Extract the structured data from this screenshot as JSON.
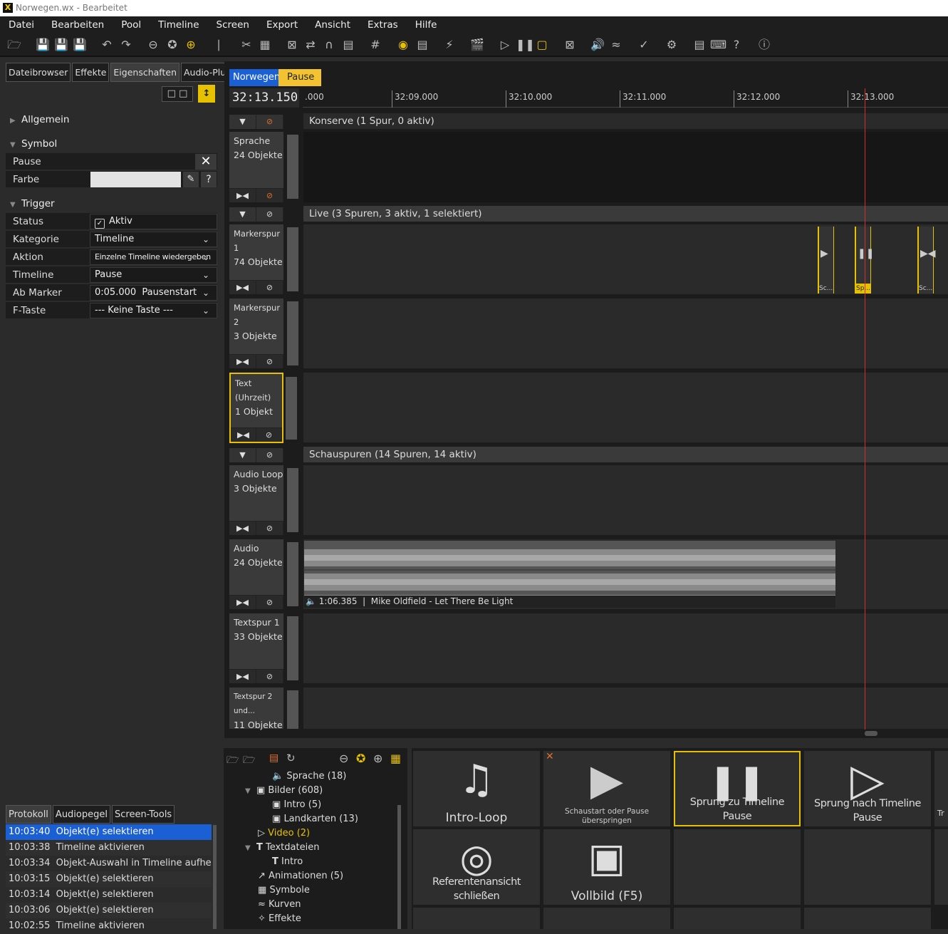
{
  "window": {
    "title": "Norwegen.wx - Bearbeitet",
    "app_icon": "X"
  },
  "menu": [
    "Datei",
    "Bearbeiten",
    "Pool",
    "Timeline",
    "Screen",
    "Export",
    "Ansicht",
    "Extras",
    "Hilfe"
  ],
  "left_tabs": [
    "Dateibrowser",
    "Effekte",
    "Eigenschaften",
    "Audio-Plugins"
  ],
  "properties": {
    "allgemein": "Allgemein",
    "symbol": "Symbol",
    "symbol_name": "Pause",
    "farbe_label": "Farbe",
    "trigger": "Trigger",
    "status_label": "Status",
    "status_value": "Aktiv",
    "kategorie_label": "Kategorie",
    "kategorie_value": "Timeline",
    "aktion_label": "Aktion",
    "aktion_value": "Einzelne Timeline wiedergeben",
    "timeline_label": "Timeline",
    "timeline_value": "Pause",
    "abmarker_label": "Ab Marker",
    "abmarker_value": "0:05.000  Pausenstart",
    "ftaste_label": "F-Taste",
    "ftaste_value": "--- Keine Taste ---"
  },
  "bottom_left_tabs": [
    "Protokoll",
    "Audiopegel",
    "Screen-Tools"
  ],
  "log": [
    {
      "time": "10:03:40",
      "text": "Objekt(e) selektieren"
    },
    {
      "time": "10:03:38",
      "text": "Timeline aktivieren"
    },
    {
      "time": "10:03:34",
      "text": "Objekt-Auswahl in Timeline aufheben"
    },
    {
      "time": "10:03:15",
      "text": "Objekt(e) selektieren"
    },
    {
      "time": "10:03:14",
      "text": "Objekt(e) selektieren"
    },
    {
      "time": "10:03:06",
      "text": "Objekt(e) selektieren"
    },
    {
      "time": "10:02:55",
      "text": "Timeline aktivieren"
    }
  ],
  "timeline": {
    "tabs": [
      "Norwegen",
      "Pause"
    ],
    "time": "32:13.150",
    "ruler": [
      ".000",
      "32:09.000",
      "32:10.000",
      "32:11.000",
      "32:12.000",
      "32:13.000"
    ],
    "groups": {
      "konserve": "Konserve  (1 Spur, 0 aktiv)",
      "live": "Live  (3 Spuren, 3 aktiv, 1 selektiert)",
      "schau": "Schauspuren  (14 Spuren, 14 aktiv)"
    },
    "tracks": {
      "sprache": {
        "name": "Sprache",
        "count": "24 Objekte"
      },
      "marker1": {
        "name": "Markerspur 1",
        "count": "74 Objekte"
      },
      "marker2": {
        "name": "Markerspur 2",
        "count": "3 Objekte"
      },
      "text": {
        "name": "Text (Uhrzeit)",
        "count": "1 Objekt"
      },
      "audioloop": {
        "name": "Audio Loop",
        "count": "3 Objekte"
      },
      "audio": {
        "name": "Audio",
        "count": "24 Objekte"
      },
      "textspur1": {
        "name": "Textspur 1",
        "count": "33 Objekte"
      },
      "textspur2": {
        "name": "Textspur 2 und...",
        "count": "11 Objekte"
      }
    },
    "markers": [
      "Sc...",
      "Sp...",
      "Sc..."
    ],
    "audio_clip": "1:06.385  |  Mike Oldfield - Let There Be Light"
  },
  "pool_tree": [
    {
      "label": "Sprache (18)",
      "icon": "speaker-icon"
    },
    {
      "label": "Bilder (608)",
      "icon": "image-icon"
    },
    {
      "label": "Intro (5)",
      "icon": "image-icon"
    },
    {
      "label": "Landkarten (13)",
      "icon": "image-icon"
    },
    {
      "label": "Video (2)",
      "icon": "video-icon"
    },
    {
      "label": "Textdateien",
      "icon": "text-icon"
    },
    {
      "label": "Intro",
      "icon": "text-icon"
    },
    {
      "label": "Animationen (5)",
      "icon": "animation-icon"
    },
    {
      "label": "Symbole",
      "icon": "symbol-icon"
    },
    {
      "label": "Kurven",
      "icon": "curve-icon"
    },
    {
      "label": "Effekte",
      "icon": "effect-icon"
    }
  ],
  "tiles": {
    "intro_loop": "Intro-Loop",
    "schaustart_1": "Schaustart oder Pause",
    "schaustart_2": "überspringen",
    "sprung_zu": "Sprung zu Timeline Pause",
    "sprung_nach": "Sprung nach Timeline Pause",
    "ref": "Referentenansicht schließen",
    "vollbild": "Vollbild (F5)",
    "partial": "Tr"
  },
  "colors": {
    "accent": "#e5c100",
    "selection": "#1a5fd4",
    "playhead": "#d32f2f"
  }
}
